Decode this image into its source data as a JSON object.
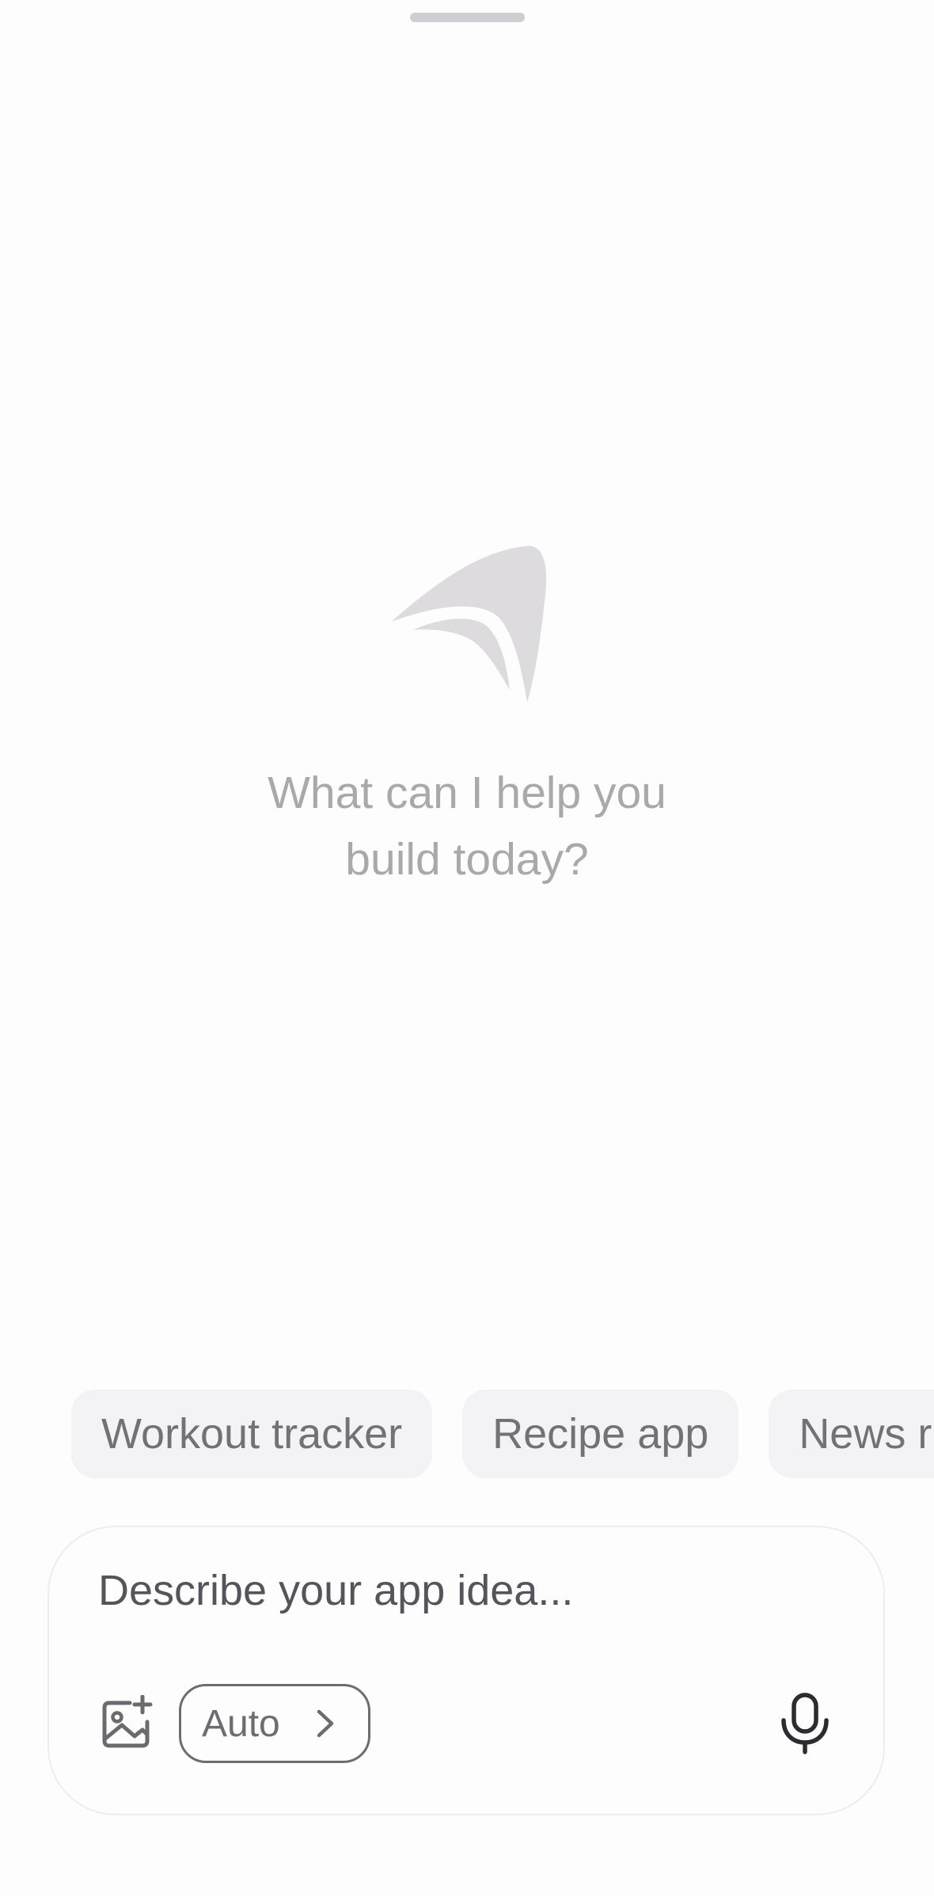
{
  "hero": {
    "logo_icon": "sail-logo-icon",
    "prompt_line1": "What can I help you",
    "prompt_line2": "build today?"
  },
  "suggestions": [
    {
      "label": "Workout tracker"
    },
    {
      "label": "Recipe app"
    },
    {
      "label": "News r"
    }
  ],
  "composer": {
    "placeholder": "Describe your app idea...",
    "value": "",
    "attach_icon": "image-add-icon",
    "model_label": "Auto",
    "model_icon": "chevron-right-icon",
    "mic_icon": "microphone-icon"
  },
  "colors": {
    "background": "#fefdfe",
    "chip_background": "#f3f2f4",
    "logo": "#dddbde",
    "prompt_text": "#a9a8ab"
  }
}
